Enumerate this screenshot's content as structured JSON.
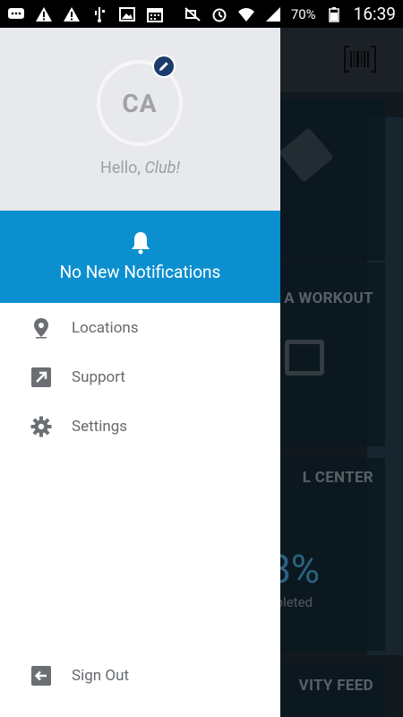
{
  "status_bar": {
    "battery": "70%",
    "time": "16:39"
  },
  "drawer": {
    "avatar_initials": "CA",
    "greeting_prefix": "Hello, ",
    "greeting_name": "Club!",
    "notification_text": "No New Notifications",
    "menu": [
      {
        "label": "Locations",
        "icon": "location-pin-icon"
      },
      {
        "label": "Support",
        "icon": "external-link-icon"
      },
      {
        "label": "Settings",
        "icon": "gear-icon"
      }
    ],
    "sign_out_label": "Sign Out"
  },
  "background": {
    "card2_title": "D A WORKOUT",
    "card3_title": "L CENTER",
    "progress_value": "8%",
    "progress_label": "mpleted",
    "card4_title": "VITY FEED"
  },
  "colors": {
    "accent": "#0b8fcf",
    "header_bg": "#e8e9ec",
    "badge": "#1b3b6b"
  }
}
